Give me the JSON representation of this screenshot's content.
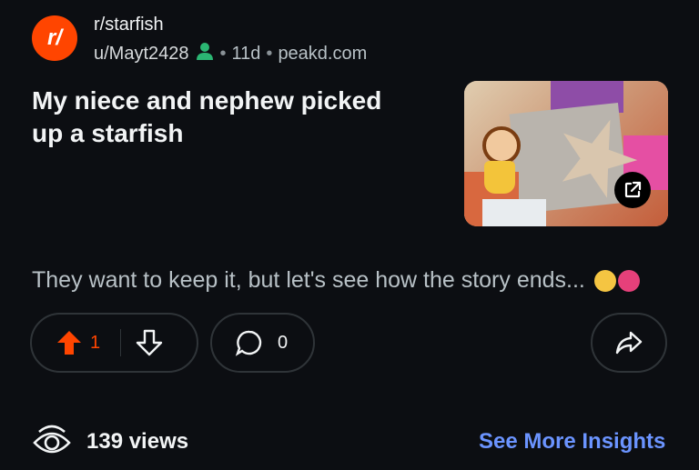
{
  "post": {
    "subreddit": "r/starfish",
    "avatar_text": "r/",
    "username": "u/Mayt2428",
    "age": "11d",
    "domain": "peakd.com",
    "title": "My niece and nephew picked up a starfish",
    "body": "They want to keep it, but let's see how the story ends...",
    "thumbnail_icon": "external-link-icon"
  },
  "actions": {
    "upvotes": "1",
    "comments": "0"
  },
  "footer": {
    "views": "139 views",
    "insights": "See More Insights"
  },
  "colors": {
    "background": "#0c0e12",
    "accent": "#ff4500",
    "link": "#6b94ff"
  }
}
